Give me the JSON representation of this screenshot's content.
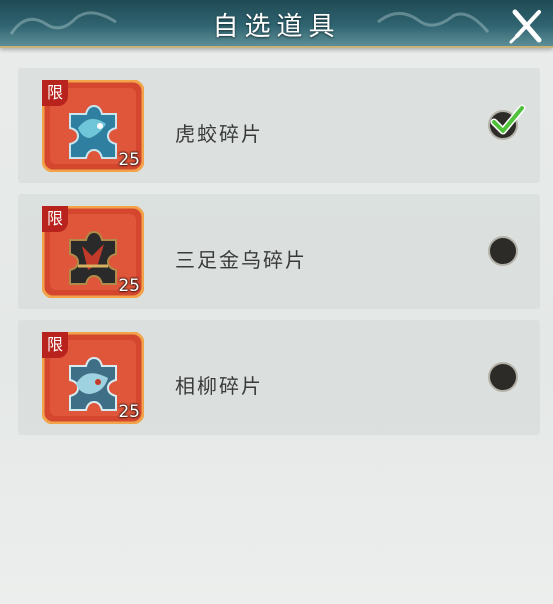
{
  "header": {
    "title": "自选道具",
    "close_icon": "close-icon"
  },
  "items": [
    {
      "badge": "限",
      "name": "虎蛟碎片",
      "count": "25",
      "selected": true,
      "icon": "dragon-fragment-icon"
    },
    {
      "badge": "限",
      "name": "三足金乌碎片",
      "count": "25",
      "selected": false,
      "icon": "crow-fragment-icon"
    },
    {
      "badge": "限",
      "name": "相柳碎片",
      "count": "25",
      "selected": false,
      "icon": "serpent-fragment-icon"
    }
  ],
  "colors": {
    "header": "#2f6470",
    "badge": "#b8231e",
    "card": "#d6dbda",
    "check": "#4fc13a"
  }
}
